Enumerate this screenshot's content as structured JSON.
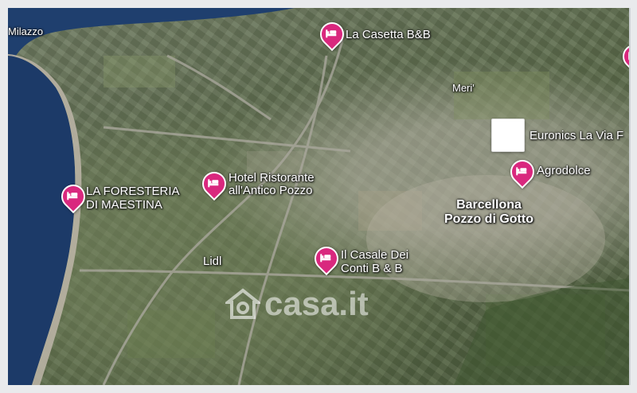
{
  "map": {
    "places": {
      "milazzo": "Milazzo",
      "meri": "Meri'",
      "lidl": "Lidl",
      "barcellona": "Barcellona\nPozzo di Gotto"
    },
    "pins": [
      {
        "label": "La Casetta B&B",
        "icon": "bed-icon"
      },
      {
        "label": "LA FORESTERIA\nDI MAESTINA",
        "icon": "bed-icon"
      },
      {
        "label": "Hotel Ristorante\nall'Antico Pozzo",
        "icon": "bed-icon"
      },
      {
        "label": "Agrodolce",
        "icon": "bed-icon"
      },
      {
        "label": "Il Casale Dei\nConti B & B",
        "icon": "bed-icon"
      },
      {
        "label": "",
        "icon": "bed-icon"
      }
    ],
    "store": {
      "label": "Euronics La Via F"
    },
    "watermark": "casa.it",
    "colors": {
      "pin": "#d9287e",
      "sea": "#1d3f70",
      "label": "#ffffff"
    }
  }
}
